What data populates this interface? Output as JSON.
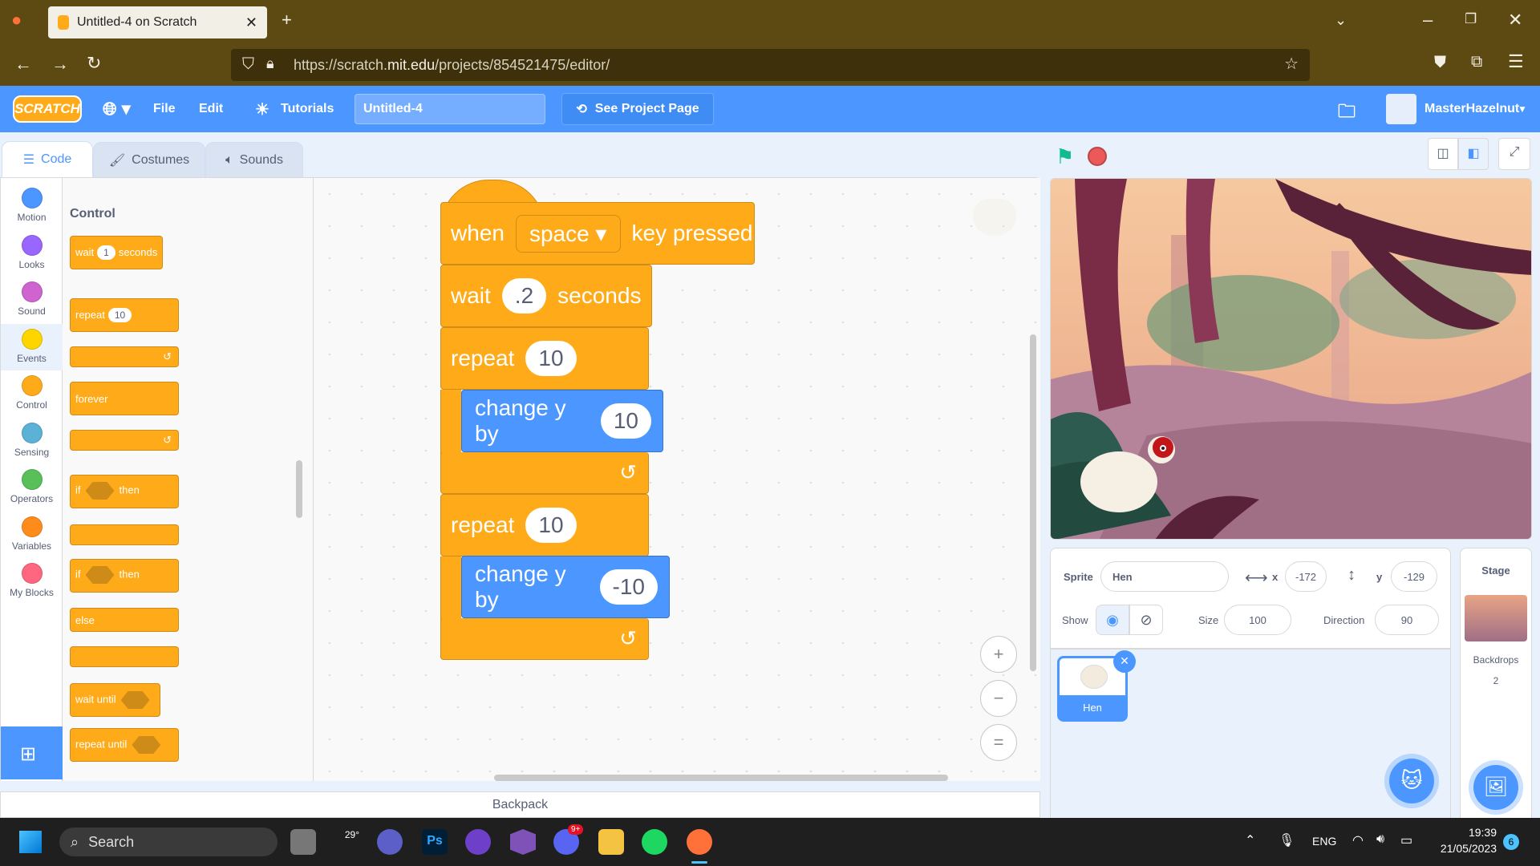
{
  "browser": {
    "tab_title": "Untitled-4 on Scratch",
    "new_tab": "+",
    "url_prefix": "https://scratch.",
    "url_host": "mit.edu",
    "url_path": "/projects/854521475/editor/"
  },
  "menubar": {
    "logo": "SCRATCH",
    "file": "File",
    "edit": "Edit",
    "tutorials": "Tutorials",
    "project_title": "Untitled-4",
    "see_project": "See Project Page",
    "username": "MasterHazelnut"
  },
  "tabs": {
    "code": "Code",
    "costumes": "Costumes",
    "sounds": "Sounds"
  },
  "categories": [
    {
      "label": "Motion",
      "color": "#4c97ff"
    },
    {
      "label": "Looks",
      "color": "#9966ff"
    },
    {
      "label": "Sound",
      "color": "#cf63cf"
    },
    {
      "label": "Events",
      "color": "#ffd500"
    },
    {
      "label": "Control",
      "color": "#ffab19"
    },
    {
      "label": "Sensing",
      "color": "#5cb1d6"
    },
    {
      "label": "Operators",
      "color": "#59c059"
    },
    {
      "label": "Variables",
      "color": "#ff8c1a"
    },
    {
      "label": "My Blocks",
      "color": "#ff6680"
    }
  ],
  "palette": {
    "title": "Control",
    "wait": "wait",
    "wait_val": "1",
    "seconds": "seconds",
    "repeat": "repeat",
    "repeat_val": "10",
    "forever": "forever",
    "if": "if",
    "then": "then",
    "else": "else",
    "wait_until": "wait until",
    "repeat_until": "repeat until"
  },
  "script": {
    "when": "when",
    "key": "space",
    "key_pressed": "key pressed",
    "wait": "wait",
    "wait_val": ".2",
    "seconds": "seconds",
    "repeat1": "repeat",
    "repeat1_val": "10",
    "change1": "change y by",
    "change1_val": "10",
    "repeat2": "repeat",
    "repeat2_val": "10",
    "change2": "change y by",
    "change2_val": "-10"
  },
  "backpack": "Backpack",
  "sprite_info": {
    "sprite_label": "Sprite",
    "sprite_name": "Hen",
    "x_label": "x",
    "x_val": "-172",
    "y_label": "y",
    "y_val": "-129",
    "show_label": "Show",
    "size_label": "Size",
    "size_val": "100",
    "direction_label": "Direction",
    "direction_val": "90"
  },
  "sprite_list": [
    {
      "name": "Hen"
    }
  ],
  "stage_panel": {
    "title": "Stage",
    "backdrops_label": "Backdrops",
    "backdrops_count": "2"
  },
  "taskbar": {
    "search": "Search",
    "weather": "29°",
    "discord_badge": "9+",
    "lang": "ENG",
    "time": "19:39",
    "date": "21/05/2023",
    "notif": "6"
  }
}
